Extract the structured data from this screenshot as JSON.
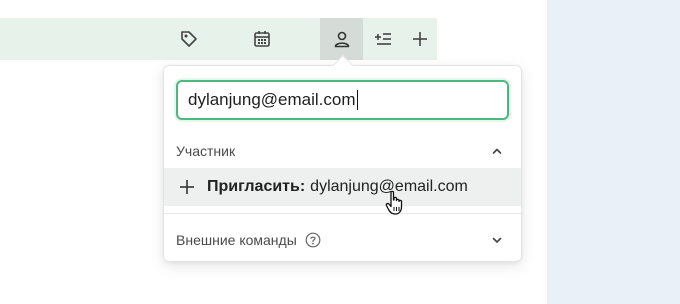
{
  "toolbar": {
    "icons": [
      "tag-icon",
      "calendar-icon",
      "user-icon",
      "add-list-icon",
      "plus-icon"
    ]
  },
  "popover": {
    "email_input": {
      "value": "dylanjung@email.com"
    },
    "member_section": {
      "label": "Участник",
      "expanded": true
    },
    "invite": {
      "label_bold": "Пригласить:",
      "email": "dylanjung@email.com"
    },
    "teams_section": {
      "label": "Внешние команды",
      "expanded": false
    }
  },
  "colors": {
    "toolbar_bg": "#e6f2ea",
    "active_btn_bg": "#d5dcd8",
    "input_border": "#4cb97a",
    "right_panel_bg": "#e9f0f7"
  }
}
